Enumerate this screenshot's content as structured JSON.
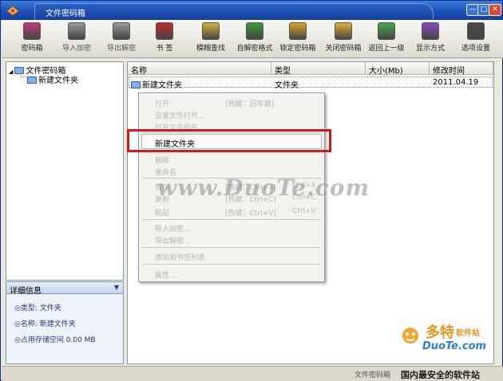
{
  "window": {
    "title": "文件密码箱"
  },
  "toolbar": {
    "buttons": [
      {
        "label": "密码箱",
        "icon": "vault-icon",
        "color": "#c2397e"
      },
      {
        "label": "导入加密",
        "icon": "import-encrypt-icon",
        "color": "#9a9a9a"
      },
      {
        "label": "导出解密",
        "icon": "export-decrypt-icon",
        "color": "#9a9a9a"
      },
      {
        "label": "书  签",
        "icon": "bookmark-icon",
        "color": "#c02a2a"
      },
      {
        "label": "模糊查找",
        "icon": "search-icon",
        "color": "#d8b23a"
      },
      {
        "label": "自解密格式",
        "icon": "self-decrypt-icon",
        "color": "#3a9a3a"
      },
      {
        "label": "锁定密码箱",
        "icon": "lock-icon",
        "color": "#d9a62a"
      },
      {
        "label": "关闭密码箱",
        "icon": "close-vault-icon",
        "color": "#e0b03a"
      },
      {
        "label": "返回上一级",
        "icon": "up-level-icon",
        "color": "#48a848"
      },
      {
        "label": "显示方式",
        "icon": "view-mode-icon",
        "color": "#8a4ac8"
      },
      {
        "label": "选项设置",
        "icon": "settings-icon",
        "color": "#4a4a4a"
      }
    ]
  },
  "tree": {
    "root": "文件密码箱",
    "child": "新建文件夹"
  },
  "list": {
    "columns": [
      "名称",
      "类型",
      "大小(Mb)",
      "修改时间"
    ],
    "rows": [
      {
        "name": "新建文件夹",
        "type": "文件夹",
        "size": "",
        "modified": "2011.04.19"
      }
    ]
  },
  "context_menu": {
    "items": [
      {
        "label": "打开",
        "key": "[热键：回车键]",
        "key2": "",
        "enabled": false
      },
      {
        "label": "设置文件打开…",
        "key": "",
        "key2": "",
        "enabled": false
      },
      {
        "label": "打开文件所在…",
        "key": "",
        "key2": "",
        "enabled": false
      },
      {
        "label": "新建文件夹",
        "key": "",
        "key2": "",
        "enabled": true
      },
      {
        "label": "删除",
        "key": "",
        "key2": "",
        "enabled": false
      },
      {
        "label": "重命名",
        "key": "",
        "key2": "",
        "enabled": false
      },
      {
        "label": "剪切",
        "key": "[热键：Ctrl+X]",
        "key2": "Ctrl+X",
        "enabled": false
      },
      {
        "label": "复制",
        "key": "[热键：Ctrl+C]",
        "key2": "Ctrl+C",
        "enabled": false
      },
      {
        "label": "粘贴",
        "key": "[热键：Ctrl+V]",
        "key2": "Ctrl+V",
        "enabled": false
      },
      {
        "label": "导入加密…",
        "key": "",
        "key2": "",
        "enabled": false
      },
      {
        "label": "导出解密…",
        "key": "",
        "key2": "",
        "enabled": false
      },
      {
        "label": "添加到书签列表",
        "key": "",
        "key2": "",
        "enabled": false
      },
      {
        "label": "属性…",
        "key": "",
        "key2": "",
        "enabled": false
      }
    ]
  },
  "details": {
    "header": "详细信息",
    "type": "◎类型: 文件夹",
    "name": "◎名称: 新建文件夹",
    "space": "◎占用存储空间 0.00 MB"
  },
  "watermark": "www.DuoTe.com",
  "logo": {
    "cn": "多特",
    "sub": "软件站",
    "en": "DuoTe.com"
  },
  "status": {
    "left": "文件密码箱",
    "right": "国内最安全的软件站"
  }
}
